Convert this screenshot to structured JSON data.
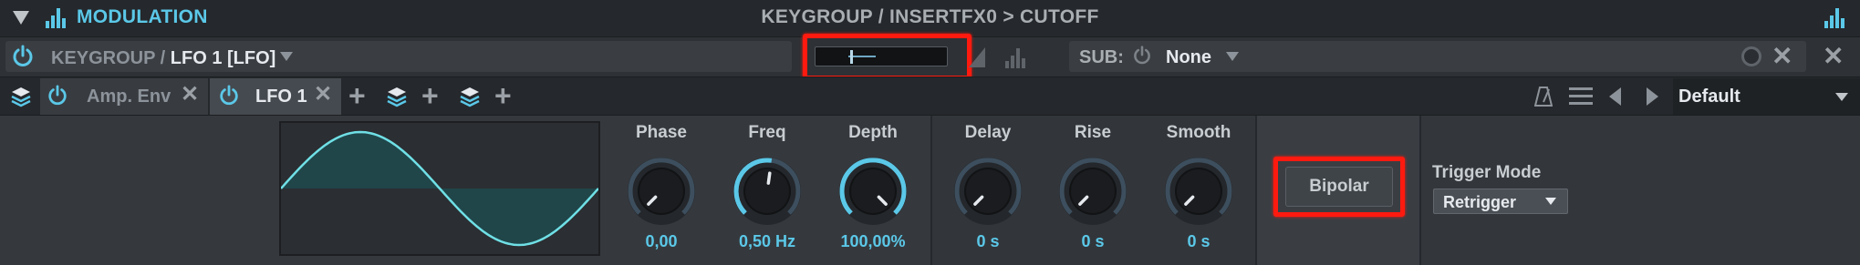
{
  "header": {
    "title": "MODULATION",
    "path": "KEYGROUP / INSERTFX0 > CUTOFF"
  },
  "source": {
    "keygroup_label": "KEYGROUP",
    "separator": "/",
    "lfo_label": "LFO 1 [LFO]"
  },
  "sub": {
    "label": "SUB:",
    "value": "None"
  },
  "tabs": [
    {
      "label": "Amp. Env"
    },
    {
      "label": "LFO 1"
    }
  ],
  "preset": {
    "value": "Default"
  },
  "lfo": {
    "knobs": [
      {
        "label": "Phase",
        "value": "0,00",
        "level": 0.0
      },
      {
        "label": "Freq",
        "value": "0,50 Hz",
        "level": 0.53
      },
      {
        "label": "Depth",
        "value": "100,00%",
        "level": 1.0
      }
    ]
  },
  "envelope": {
    "knobs": [
      {
        "label": "Delay",
        "value": "0 s",
        "level": 0.0
      },
      {
        "label": "Rise",
        "value": "0 s",
        "level": 0.0
      },
      {
        "label": "Smooth",
        "value": "0 s",
        "level": 0.0
      }
    ]
  },
  "bipolar": {
    "label": "Bipolar"
  },
  "trigger": {
    "label": "Trigger Mode",
    "value": "Retrigger"
  },
  "colors": {
    "accent": "#5bc8e8",
    "highlight": "#ff1a0f"
  }
}
